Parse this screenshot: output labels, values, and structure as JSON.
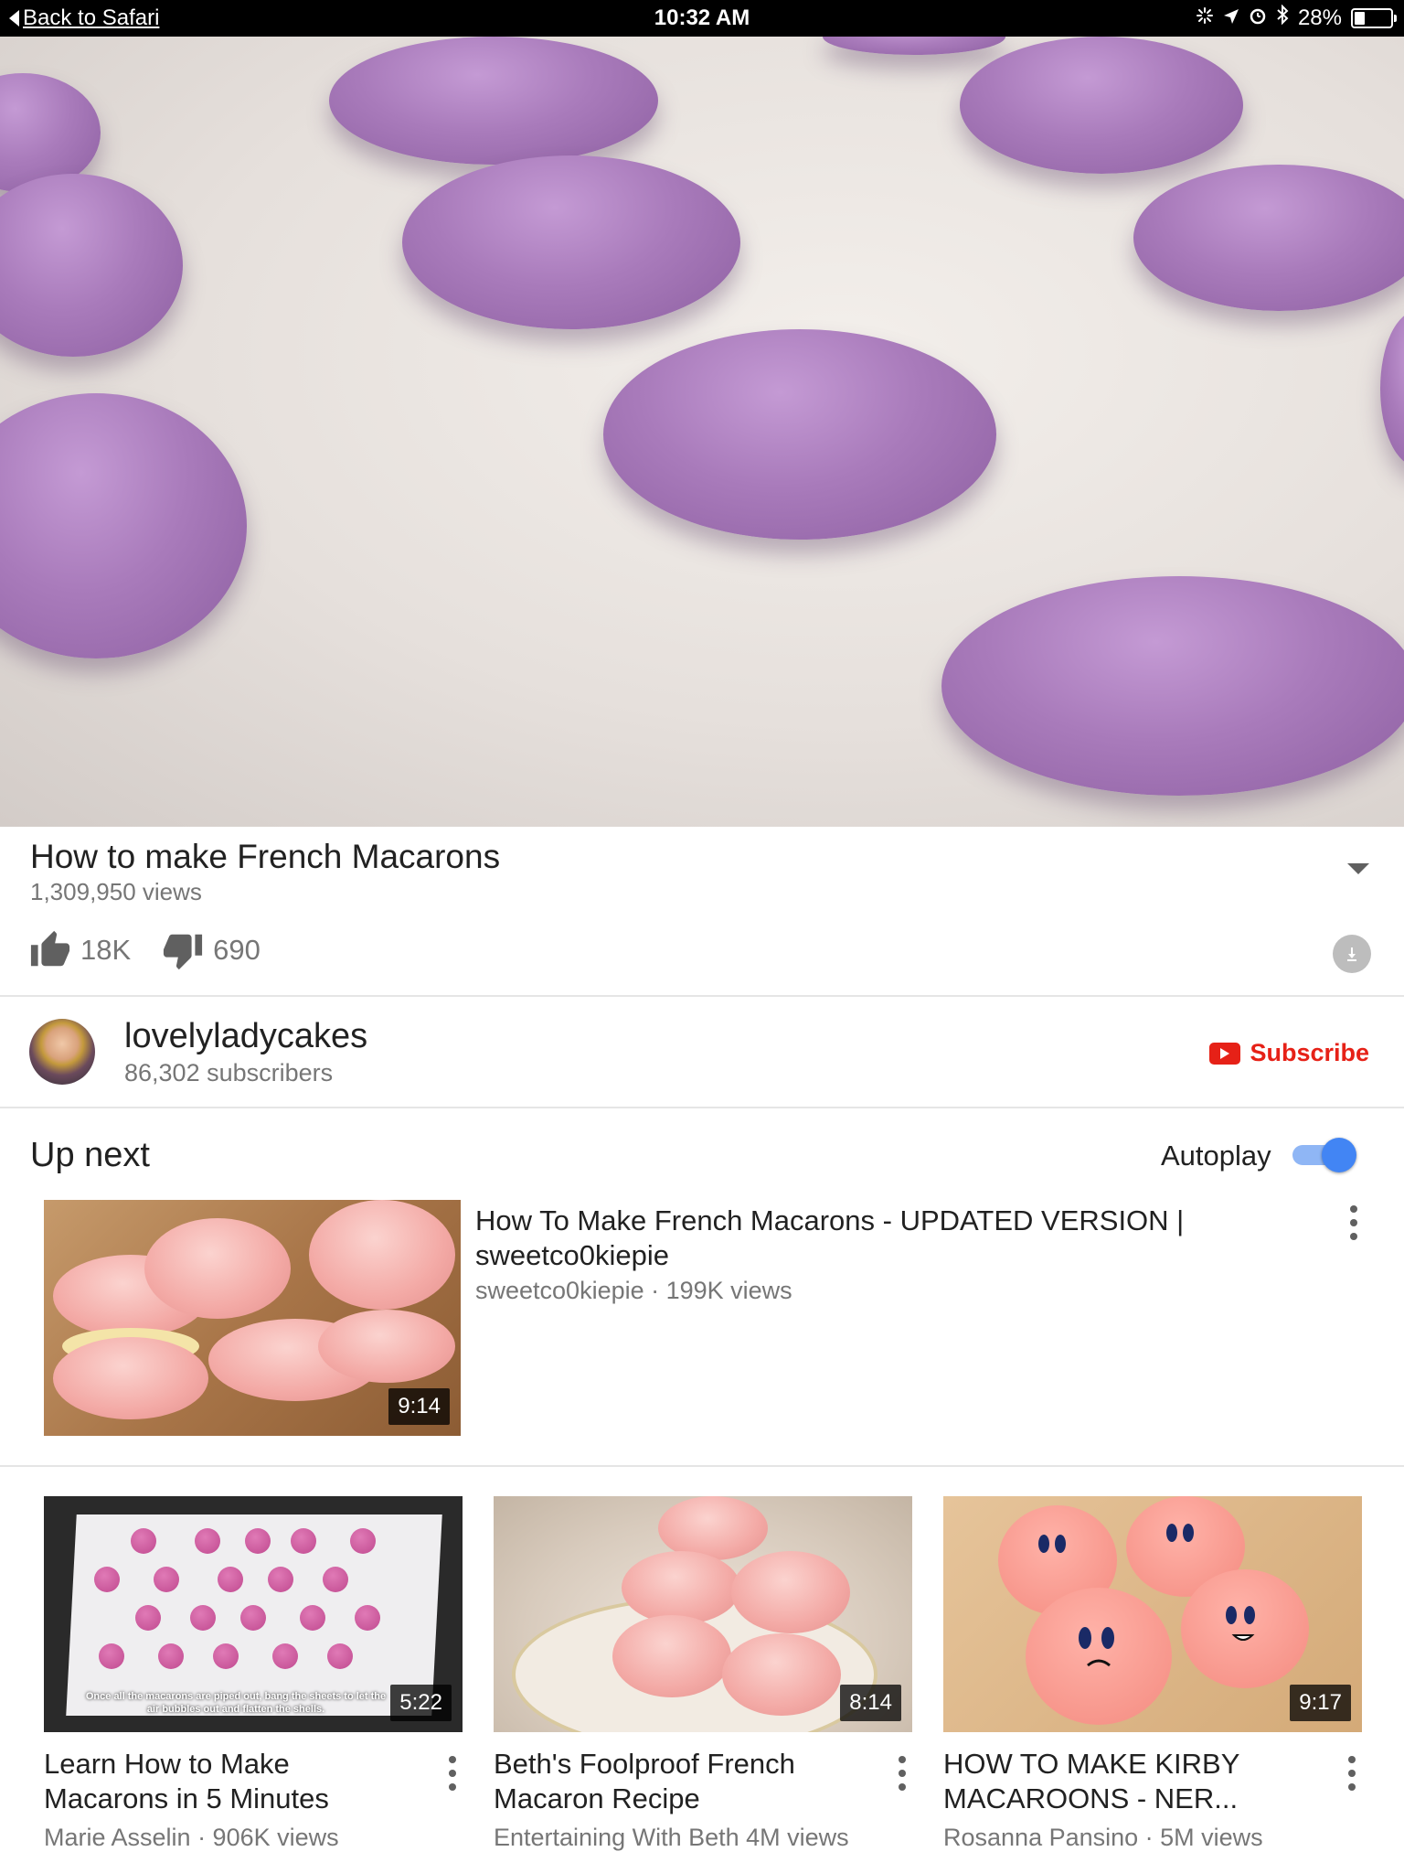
{
  "status_bar": {
    "back_label": "Back to Safari",
    "time": "10:32 AM",
    "battery": "28%",
    "battery_level": 0.28,
    "icons": [
      "activity-icon",
      "location-icon",
      "alarm-icon",
      "bluetooth-icon"
    ]
  },
  "video": {
    "title": "How to make French Macarons",
    "views": "1,309,950 views",
    "likes": "18K",
    "dislikes": "690"
  },
  "channel": {
    "name": "lovelyladycakes",
    "subscribers": "86,302 subscribers",
    "subscribe_label": "Subscribe"
  },
  "up_next": {
    "label": "Up next",
    "autoplay_label": "Autoplay",
    "autoplay_on": true,
    "first": {
      "title": "How To Make French Macarons - UPDATED VERSION | sweetco0kiepie",
      "meta": "sweetco0kiepie · 199K views",
      "duration": "9:14"
    },
    "items": [
      {
        "title": "Learn How to Make Macarons in 5 Minutes",
        "meta": "Marie Asselin · 906K views",
        "duration": "5:22",
        "caption": "Once all the macarons are piped out, bang the sheets to let the air bubbles out and flatten the shells."
      },
      {
        "title": "Beth's Foolproof French Macaron Recipe",
        "meta": "Entertaining With Beth 4M views",
        "duration": "8:14"
      },
      {
        "title": "HOW TO MAKE KIRBY MACAROONS - NER...",
        "meta": "Rosanna Pansino · 5M views",
        "duration": "9:17"
      }
    ]
  },
  "colors": {
    "accent_red": "#e62117",
    "toggle_blue": "#4285f4",
    "macaron_purple": "#a97bbb"
  }
}
